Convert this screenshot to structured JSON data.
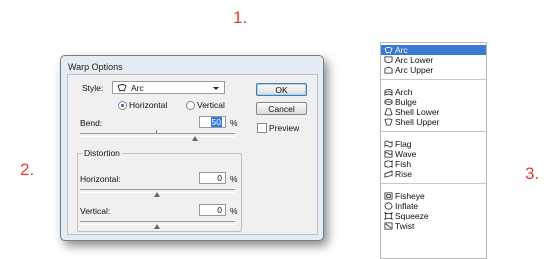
{
  "steps": [
    "1.",
    "2.",
    "3."
  ],
  "dialog": {
    "title": "Warp Options",
    "style_label": "Style:",
    "style_value": "Arc",
    "horizontal_label": "Horizontal",
    "vertical_label": "Vertical",
    "orientation_selected": "Horizontal",
    "bend_label": "Bend:",
    "bend_value": "50",
    "percent": "%",
    "distortion_label": "Distortion",
    "dist_horizontal_label": "Horizontal:",
    "dist_horizontal_value": "0",
    "dist_vertical_label": "Vertical:",
    "dist_vertical_value": "0",
    "ok_label": "OK",
    "cancel_label": "Cancel",
    "preview_label": "Preview",
    "preview_checked": false
  },
  "style_list": {
    "selected": "Arc",
    "groups": [
      [
        "Arc",
        "Arc Lower",
        "Arc Upper"
      ],
      [
        "Arch",
        "Bulge",
        "Shell Lower",
        "Shell Upper"
      ],
      [
        "Flag",
        "Wave",
        "Fish",
        "Rise"
      ],
      [
        "Fisheye",
        "Inflate",
        "Squeeze",
        "Twist"
      ]
    ]
  },
  "colors": {
    "accent": "#3a79d6",
    "step_number": "#d8423c"
  }
}
